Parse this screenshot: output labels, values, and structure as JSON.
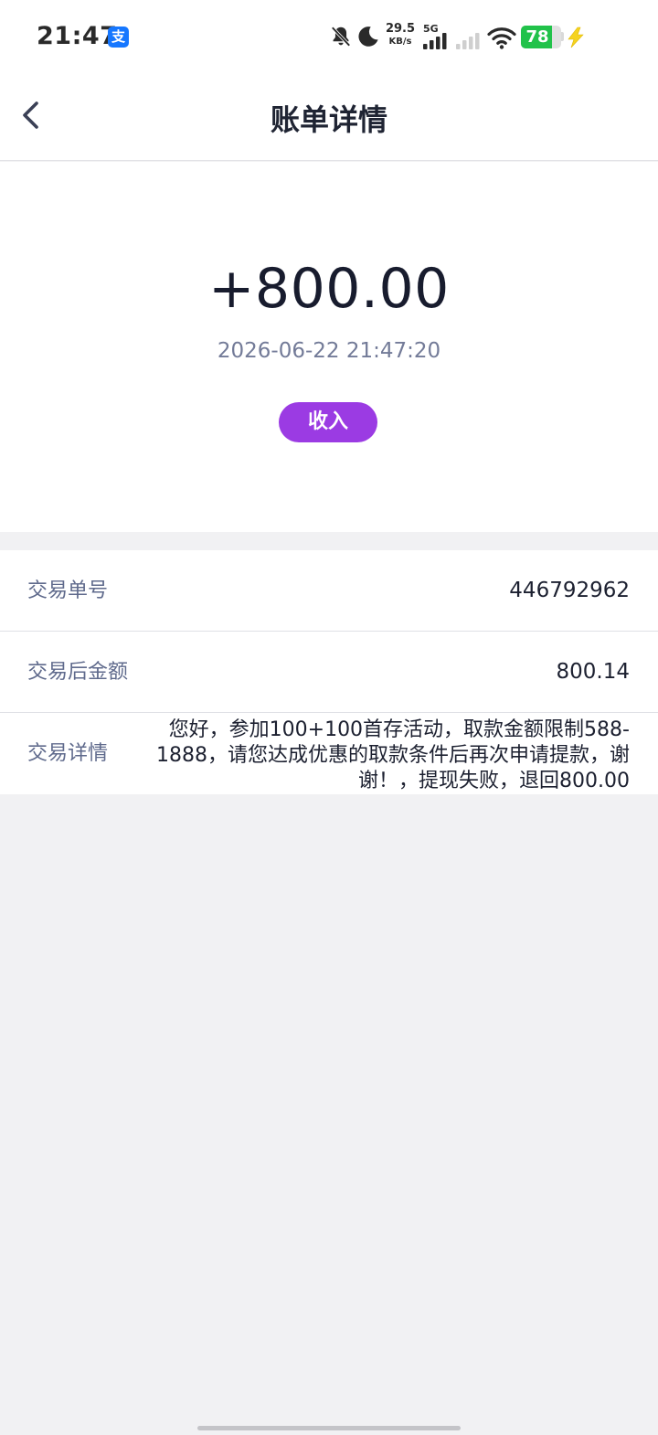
{
  "status_bar": {
    "time": "21:47",
    "app_icon": "alipay-icon",
    "alipay_glyph": "支",
    "icons": [
      "bell-mute-icon",
      "moon-icon",
      "signal-icon",
      "signal-weak-icon",
      "wifi-icon",
      "charging-bolt-icon"
    ],
    "network_speed_value": "29.5",
    "network_speed_unit": "KB/s",
    "network_type": "5G",
    "battery_level": "78",
    "battery_color": "#21c24a",
    "bolt_color": "#f5d31f"
  },
  "nav": {
    "back_icon": "chevron-left-icon",
    "title": "账单详情"
  },
  "summary": {
    "amount": "+800.00",
    "datetime": "2026-06-22 21:47:20",
    "type_label": "收入",
    "type_color": "#9b3be3"
  },
  "details": {
    "rows": [
      {
        "label": "交易单号",
        "value": "446792962"
      },
      {
        "label": "交易后金额",
        "value": "800.14"
      },
      {
        "label": "交易详情",
        "value": "您好，参加100+100首存活动，取款金额限制588-1888，请您达成优惠的取款条件后再次申请提款，谢谢！，提现失败，退回800.00"
      }
    ]
  }
}
